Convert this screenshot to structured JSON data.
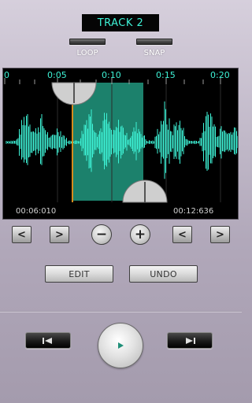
{
  "track": {
    "title": "TRACK 2"
  },
  "toggles": {
    "loop_label": "LOOP",
    "snap_label": "SNAP"
  },
  "timeline": {
    "ticks": [
      "0",
      "0:05",
      "0:10",
      "0:15",
      "0:20"
    ],
    "start_time": "00:06:010",
    "end_time": "00:12:636"
  },
  "controls": {
    "left_arrow": "<",
    "right_arrow": ">",
    "zoom_out": "−",
    "zoom_in": "+",
    "edit_label": "EDIT",
    "undo_label": "UNDO"
  },
  "colors": {
    "waveform": "#3ef2d6",
    "selection": "#1f8f78",
    "playhead": "#d58a1e",
    "title_text": "#3ef2d6"
  },
  "icons": {
    "rewind": "skip-back-icon",
    "play": "play-icon",
    "forward": "skip-forward-icon"
  }
}
